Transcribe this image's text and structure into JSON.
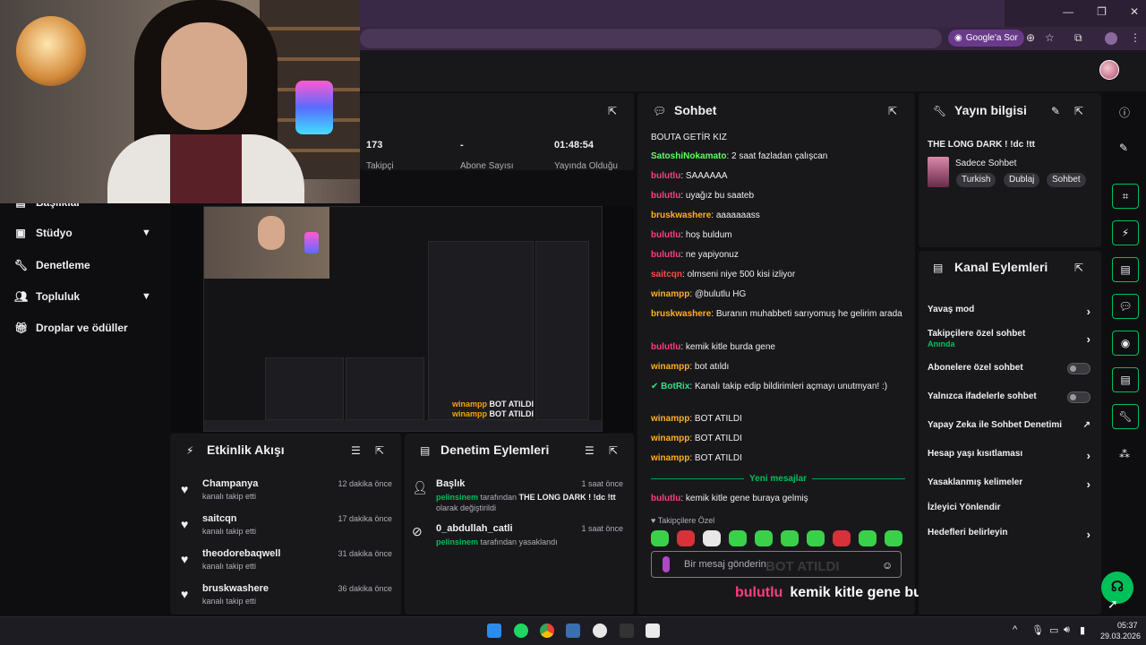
{
  "browser": {
    "google_ask": "Google'a Sor",
    "win_controls": [
      "—",
      "❐",
      "✕"
    ]
  },
  "sidebar": {
    "partial_item": "Başlıklar",
    "items": [
      {
        "label": "Stüdyo",
        "icon": "studio-icon",
        "expandable": true
      },
      {
        "label": "Denetleme",
        "icon": "wrench-icon",
        "expandable": false
      },
      {
        "label": "Topluluk",
        "icon": "community-icon",
        "expandable": true
      },
      {
        "label": "Droplar ve ödüller",
        "icon": "gift-icon",
        "expandable": false
      }
    ]
  },
  "stats": {
    "followers_value": "173",
    "followers_label": "Takipçi",
    "subs_value": "-",
    "subs_label": "Abone Sayısı",
    "uptime_value": "01:48:54",
    "uptime_label": "Yayında Olduğu"
  },
  "preview": {
    "mini_chat": [
      {
        "user": "winampp",
        "text": "BOT ATILDI"
      },
      {
        "user": "winampp",
        "text": "BOT ATILDI"
      }
    ]
  },
  "activity": {
    "title": "Etkinlik Akışı",
    "items": [
      {
        "name": "Champanya",
        "sub": "kanalı takip etti",
        "time": "12 dakika önce"
      },
      {
        "name": "saitcqn",
        "sub": "kanalı takip etti",
        "time": "17 dakika önce"
      },
      {
        "name": "theodorebaqwell",
        "sub": "kanalı takip etti",
        "time": "31 dakika önce"
      },
      {
        "name": "bruskwashere",
        "sub": "kanalı takip etti",
        "time": "36 dakika önce"
      }
    ]
  },
  "modactions": {
    "title": "Denetim Eylemleri",
    "items": [
      {
        "name": "Başlık",
        "time": "1 saat önce",
        "actor": "pelinsinem",
        "line1": "tarafından",
        "bold": "THE LONG DARK ! !dc !tt",
        "line2": "olarak değiştirildi"
      },
      {
        "name": "0_abdullah_catli",
        "time": "1 saat önce",
        "actor": "pelinsinem",
        "line1": "tarafından yasaklandı",
        "bold": "",
        "line2": ""
      }
    ]
  },
  "chat": {
    "title": "Sohbet",
    "messages": [
      {
        "user": "",
        "color": "",
        "text": "BOUTA GETİR KIZ"
      },
      {
        "user": "SatoshiNokamato",
        "color": "green",
        "text": "2 saat fazladan çalışcan"
      },
      {
        "user": "bulutlu",
        "color": "pink",
        "text": "SAAAAAA"
      },
      {
        "user": "bulutlu",
        "color": "pink",
        "text": "uyağız bu saateb"
      },
      {
        "user": "bruskwashere",
        "color": "orange",
        "text": "aaaaaaass"
      },
      {
        "user": "bulutlu",
        "color": "pink",
        "text": "hoş buldum"
      },
      {
        "user": "bulutlu",
        "color": "pink",
        "text": "ne yapiyonuz"
      },
      {
        "user": "saitcqn",
        "color": "red",
        "text": "olmseni niye 500 kisi izliyor"
      },
      {
        "user": "winampp",
        "color": "orange",
        "text": "@bulutlu HG"
      },
      {
        "user": "bruskwashere",
        "color": "orange",
        "text": "Buranın muhabbeti sarıyomuş he gelirim arada"
      },
      {
        "user": "bulutlu",
        "color": "pink",
        "text": "kemik kitle burda gene"
      },
      {
        "user": "winampp",
        "color": "orange",
        "text": "bot atıldı"
      },
      {
        "user": "BotRix",
        "color": "botrix",
        "text": "Kanalı takip edip bildirimleri açmayı unutmyan! :)"
      },
      {
        "user": "winampp",
        "color": "orange",
        "text": "BOT ATILDI"
      },
      {
        "user": "winampp",
        "color": "orange",
        "text": "BOT ATILDI"
      },
      {
        "user": "winampp",
        "color": "orange",
        "text": "BOT ATILDI"
      }
    ],
    "new_messages_label": "Yeni mesajlar",
    "latest": {
      "user": "bulutlu",
      "text": "kemik kitle gene buraya gelmiş"
    },
    "followers_only": "Takipçilere Özel",
    "input_placeholder": "Bir mesaj gönderin",
    "input_ghost": "BOT ATILDI",
    "subtitle_user": "bulutlu",
    "subtitle_text": "kemik kitle gene buraya gelmiş"
  },
  "stream_info": {
    "title": "Yayın bilgisi",
    "stream_title": "THE LONG DARK ! !dc !tt",
    "category": "Sadece Sohbet",
    "tags": [
      "Turkish",
      "Dublaj",
      "Sohbet"
    ]
  },
  "channel_actions": {
    "title": "Kanal Eylemleri",
    "items": [
      {
        "label": "Yavaş mod",
        "sub": "",
        "control": "arrow"
      },
      {
        "label": "Takipçilere özel sohbet",
        "sub": "Anında",
        "control": "arrow"
      },
      {
        "label": "Abonelere özel sohbet",
        "sub": "",
        "control": "toggle"
      },
      {
        "label": "Yalnızca ifadelerle sohbet",
        "sub": "",
        "control": "toggle"
      },
      {
        "label": "Yapay Zeka ile Sohbet Denetimi",
        "sub": "",
        "control": "external"
      },
      {
        "label": "Hesap yaşı kısıtlaması",
        "sub": "",
        "control": "arrow"
      },
      {
        "label": "Yasaklanmış kelimeler",
        "sub": "",
        "control": "arrow"
      },
      {
        "label": "İzleyici Yönlendir",
        "sub": "",
        "control": "none"
      },
      {
        "label": "Hedefleri belirleyin",
        "sub": "",
        "control": "arrow"
      }
    ]
  },
  "taskbar": {
    "time": "05:37",
    "date": "29.03.2026"
  },
  "colors": {
    "accent": "#00c05a",
    "bg": "#0e0e10",
    "panel": "#18181b",
    "username_pink": "#ff3d7f",
    "username_orange": "#ffb020"
  }
}
